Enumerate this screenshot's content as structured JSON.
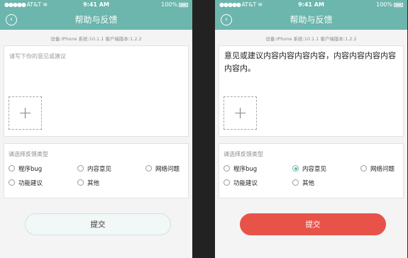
{
  "status_bar": {
    "carrier": "AT&T",
    "time": "9:41 AM",
    "battery": "100%"
  },
  "nav": {
    "back_glyph": "‹",
    "title": "帮助与反馈"
  },
  "device_info": "设备:iPhone  系统:10.1.1  客户端版本:1.2.2",
  "left": {
    "input_placeholder": "请写下你的意见或建议",
    "add_photo_glyph": "+",
    "type_label": "请选择反馈类型",
    "options": [
      {
        "label": "程序bug",
        "checked": false
      },
      {
        "label": "内容意见",
        "checked": false
      },
      {
        "label": "网络问题",
        "checked": false
      },
      {
        "label": "功能建议",
        "checked": false
      },
      {
        "label": "其他",
        "checked": false
      }
    ],
    "submit_label": "提交",
    "submit_state": "inactive"
  },
  "right": {
    "input_value": "意见或建议内容内容内容内容，内容内容内容内容内容内。",
    "add_photo_glyph": "+",
    "type_label": "请选择反馈类型",
    "options": [
      {
        "label": "程序bug",
        "checked": false
      },
      {
        "label": "内容意见",
        "checked": true
      },
      {
        "label": "网络问题",
        "checked": false
      },
      {
        "label": "功能建议",
        "checked": false
      },
      {
        "label": "其他",
        "checked": false
      }
    ],
    "submit_label": "提交",
    "submit_state": "active"
  },
  "colors": {
    "header": "#6cb6ad",
    "submit_active": "#e85349",
    "radio_checked": "#6cb6ad"
  }
}
